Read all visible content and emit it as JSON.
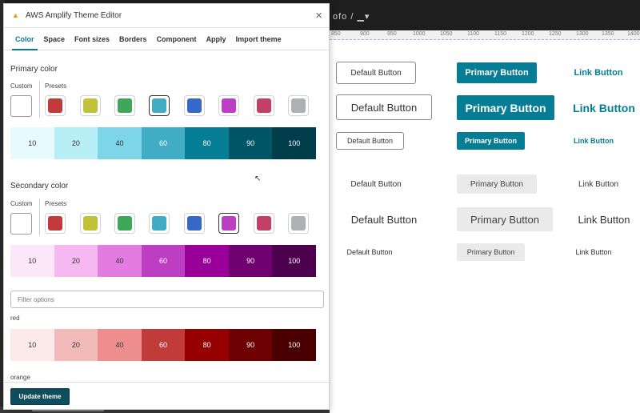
{
  "background": {
    "breadcrumb": "ofo / ▁▾",
    "ruler_ticks": [
      "850",
      "900",
      "950",
      "1000",
      "1050",
      "1100",
      "1150",
      "1200",
      "1250",
      "1300",
      "1350",
      "1400"
    ],
    "buttons": {
      "default_label": "Default Button",
      "primary_label": "Primary Button",
      "link_label": "Link Button"
    }
  },
  "panel": {
    "title": "AWS Amplify Theme Editor",
    "logo": "amplify-logo-icon",
    "close": "×",
    "tabs": [
      {
        "label": "Color",
        "active": true
      },
      {
        "label": "Space"
      },
      {
        "label": "Font sizes"
      },
      {
        "label": "Borders"
      },
      {
        "label": "Component"
      },
      {
        "label": "Apply"
      },
      {
        "label": "Import theme"
      }
    ],
    "primary": {
      "title": "Primary color",
      "custom_label": "Custom",
      "presets_label": "Presets",
      "scale": [
        {
          "label": "10",
          "bg": "#e7fafd",
          "fg": "#333"
        },
        {
          "label": "20",
          "bg": "#b8eef6",
          "fg": "#333"
        },
        {
          "label": "40",
          "bg": "#7dd6e8",
          "fg": "#333"
        },
        {
          "label": "60",
          "bg": "#40adc5",
          "fg": "#fff"
        },
        {
          "label": "80",
          "bg": "#047d95",
          "fg": "#fff"
        },
        {
          "label": "90",
          "bg": "#005566",
          "fg": "#fff"
        },
        {
          "label": "100",
          "bg": "#003e4b",
          "fg": "#fff"
        }
      ]
    },
    "secondary": {
      "title": "Secondary color",
      "custom_label": "Custom",
      "presets_label": "Presets",
      "scale": [
        {
          "label": "10",
          "bg": "#fce6fa",
          "fg": "#333"
        },
        {
          "label": "20",
          "bg": "#f6b8f0",
          "fg": "#333"
        },
        {
          "label": "40",
          "bg": "#e27ce0",
          "fg": "#333"
        },
        {
          "label": "60",
          "bg": "#bc3ec3",
          "fg": "#fff"
        },
        {
          "label": "80",
          "bg": "#990099",
          "fg": "#fff"
        },
        {
          "label": "90",
          "bg": "#6f006f",
          "fg": "#fff"
        },
        {
          "label": "100",
          "bg": "#4d004d",
          "fg": "#fff"
        }
      ]
    },
    "presets": [
      "#c13b3b",
      "#c0c23a",
      "#3ea758",
      "#40adc5",
      "#3868c6",
      "#bc3ec3",
      "#c43f67",
      "#adb1b3"
    ],
    "filter_placeholder": "Filter options",
    "red": {
      "label": "red",
      "scale": [
        {
          "label": "10",
          "bg": "#fce9e9",
          "fg": "#333"
        },
        {
          "label": "20",
          "bg": "#f3baba",
          "fg": "#333"
        },
        {
          "label": "40",
          "bg": "#ef8e8e",
          "fg": "#333"
        },
        {
          "label": "60",
          "bg": "#c13b3b",
          "fg": "#fff"
        },
        {
          "label": "80",
          "bg": "#970000",
          "fg": "#fff"
        },
        {
          "label": "90",
          "bg": "#6d0000",
          "fg": "#fff"
        },
        {
          "label": "100",
          "bg": "#4a0000",
          "fg": "#fff"
        }
      ]
    },
    "next_label": "orange",
    "update_button": "Update theme"
  }
}
